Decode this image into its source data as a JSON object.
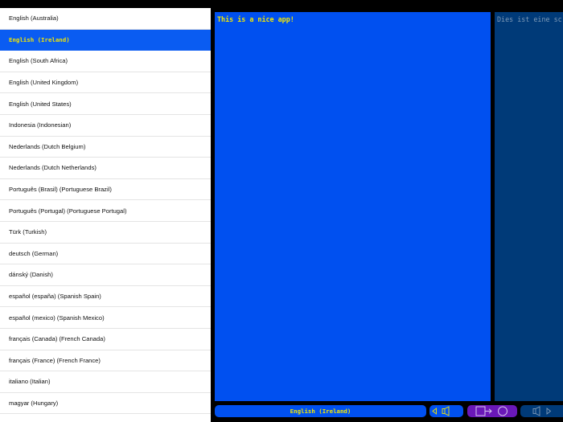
{
  "languages": [
    {
      "label": "English (Australia)",
      "selected": false
    },
    {
      "label": "English (Ireland)",
      "selected": true
    },
    {
      "label": "English (South Africa)",
      "selected": false
    },
    {
      "label": "English (United Kingdom)",
      "selected": false
    },
    {
      "label": "English (United States)",
      "selected": false
    },
    {
      "label": "Indonesia (Indonesian)",
      "selected": false
    },
    {
      "label": "Nederlands (Dutch Belgium)",
      "selected": false
    },
    {
      "label": "Nederlands (Dutch Netherlands)",
      "selected": false
    },
    {
      "label": "Português (Brasil) (Portuguese Brazil)",
      "selected": false
    },
    {
      "label": "Português (Portugal) (Portuguese Portugal)",
      "selected": false
    },
    {
      "label": "Türk (Turkish)",
      "selected": false
    },
    {
      "label": "deutsch (German)",
      "selected": false
    },
    {
      "label": "dánský (Danish)",
      "selected": false
    },
    {
      "label": "español (españa) (Spanish Spain)",
      "selected": false
    },
    {
      "label": "español (mexico) (Spanish Mexico)",
      "selected": false
    },
    {
      "label": "français (Canada) (French Canada)",
      "selected": false
    },
    {
      "label": "français (France) (French France)",
      "selected": false
    },
    {
      "label": "italiano (Italian)",
      "selected": false
    },
    {
      "label": "magyar (Hungary)",
      "selected": false
    }
  ],
  "source": {
    "text": "This is a nice app!"
  },
  "target": {
    "text": "Dies ist eine sc"
  },
  "toolbar": {
    "source_language_label": "English (Ireland)",
    "speak_icon": "speaker-icon",
    "swap_icon": "swap-arrow-icon"
  },
  "colors": {
    "accent_blue": "#0050f0",
    "selected_row": "#0a5cf2",
    "text_yellow": "#f5e900",
    "target_panel": "#003a78",
    "swap_purple": "#6a18b8"
  }
}
